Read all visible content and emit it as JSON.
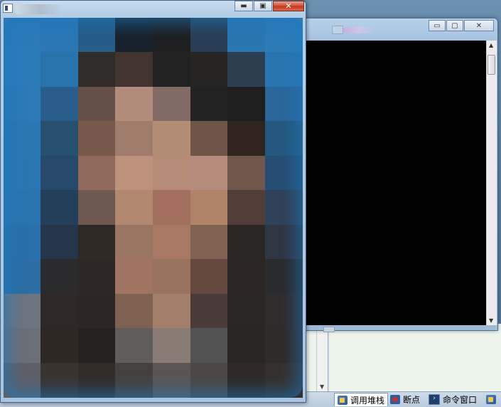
{
  "bottom_tabs": [
    {
      "label": "调用堆栈",
      "icon": "call-stack-icon",
      "active": true
    },
    {
      "label": "断点",
      "icon": "breakpoint-icon",
      "active": false
    },
    {
      "label": "命令窗口",
      "icon": "command-window-icon",
      "active": false
    }
  ],
  "console_window": {
    "caption_buttons": {
      "minimize": "▭",
      "maximize": "▢",
      "close": "✕"
    },
    "scroll_up": "▲",
    "scroll_down": "▼"
  },
  "image_window": {
    "caption_buttons": {
      "minimize": "▬",
      "maximize": "▣",
      "close": "✕"
    }
  },
  "ide_panel": {
    "scroll_down": "▼"
  },
  "colors": {
    "console_background": "#000000",
    "close_button": "#c8391e",
    "photo_background": "#2878b4"
  },
  "mosaic_colors": [
    [
      "#2b7ab8",
      "#2a77b4",
      "#265c86",
      "#18222c",
      "#1f1f21",
      "#283e55",
      "#2a76b1",
      "#2b7bb7"
    ],
    [
      "#2b7ab8",
      "#2774ad",
      "#2f2c2a",
      "#433430",
      "#222122",
      "#272524",
      "#2c3f51",
      "#2875b0"
    ],
    [
      "#2b79b6",
      "#285e89",
      "#665048",
      "#b18c7b",
      "#836b65",
      "#242324",
      "#1f1e1f",
      "#2a669a"
    ],
    [
      "#2a77b3",
      "#264f70",
      "#775a4c",
      "#a07c6c",
      "#b28c74",
      "#6f5548",
      "#30241f",
      "#25587f"
    ],
    [
      "#2a76b2",
      "#26486a",
      "#8f6a5c",
      "#be917c",
      "#b68b78",
      "#b48b7c",
      "#6f574d",
      "#264e73"
    ],
    [
      "#2a74b0",
      "#243f5a",
      "#6f584f",
      "#b28870",
      "#a3705f",
      "#b08267",
      "#503d38",
      "#2f4257"
    ],
    [
      "#2a70aa",
      "#25364a",
      "#302a27",
      "#9a7561",
      "#a87865",
      "#7f6252",
      "#292624",
      "#2f3644"
    ],
    [
      "#2c6ea5",
      "#2b2b2d",
      "#2e2725",
      "#a07461",
      "#9a7360",
      "#644940",
      "#2b2624",
      "#2a2b2e"
    ],
    [
      "#6c7580",
      "#2f2826",
      "#2c2624",
      "#7f6152",
      "#a37e6a",
      "#4a3c38",
      "#2a2624",
      "#2f2c2b"
    ],
    [
      "#6b6f78",
      "#2e2825",
      "#252120",
      "#5f5d5b",
      "#887c74",
      "#535252",
      "#292523",
      "#2f2b29"
    ],
    [
      "#5e6068",
      "#3a3431",
      "#332d2a",
      "#45413f",
      "#5b5655",
      "#4d4745",
      "#2f2a28",
      "#35302e"
    ]
  ]
}
